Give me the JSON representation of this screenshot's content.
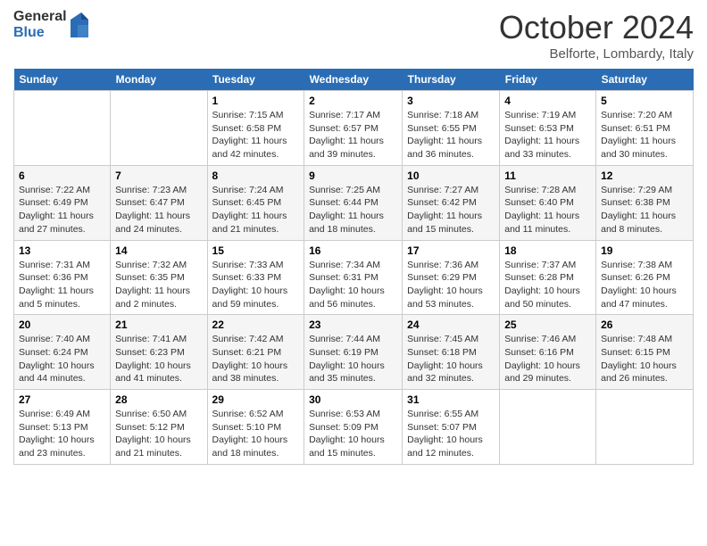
{
  "logo": {
    "general": "General",
    "blue": "Blue"
  },
  "title": "October 2024",
  "subtitle": "Belforte, Lombardy, Italy",
  "days_header": [
    "Sunday",
    "Monday",
    "Tuesday",
    "Wednesday",
    "Thursday",
    "Friday",
    "Saturday"
  ],
  "weeks": [
    [
      {
        "day": "",
        "info": ""
      },
      {
        "day": "",
        "info": ""
      },
      {
        "day": "1",
        "info": "Sunrise: 7:15 AM\nSunset: 6:58 PM\nDaylight: 11 hours and 42 minutes."
      },
      {
        "day": "2",
        "info": "Sunrise: 7:17 AM\nSunset: 6:57 PM\nDaylight: 11 hours and 39 minutes."
      },
      {
        "day": "3",
        "info": "Sunrise: 7:18 AM\nSunset: 6:55 PM\nDaylight: 11 hours and 36 minutes."
      },
      {
        "day": "4",
        "info": "Sunrise: 7:19 AM\nSunset: 6:53 PM\nDaylight: 11 hours and 33 minutes."
      },
      {
        "day": "5",
        "info": "Sunrise: 7:20 AM\nSunset: 6:51 PM\nDaylight: 11 hours and 30 minutes."
      }
    ],
    [
      {
        "day": "6",
        "info": "Sunrise: 7:22 AM\nSunset: 6:49 PM\nDaylight: 11 hours and 27 minutes."
      },
      {
        "day": "7",
        "info": "Sunrise: 7:23 AM\nSunset: 6:47 PM\nDaylight: 11 hours and 24 minutes."
      },
      {
        "day": "8",
        "info": "Sunrise: 7:24 AM\nSunset: 6:45 PM\nDaylight: 11 hours and 21 minutes."
      },
      {
        "day": "9",
        "info": "Sunrise: 7:25 AM\nSunset: 6:44 PM\nDaylight: 11 hours and 18 minutes."
      },
      {
        "day": "10",
        "info": "Sunrise: 7:27 AM\nSunset: 6:42 PM\nDaylight: 11 hours and 15 minutes."
      },
      {
        "day": "11",
        "info": "Sunrise: 7:28 AM\nSunset: 6:40 PM\nDaylight: 11 hours and 11 minutes."
      },
      {
        "day": "12",
        "info": "Sunrise: 7:29 AM\nSunset: 6:38 PM\nDaylight: 11 hours and 8 minutes."
      }
    ],
    [
      {
        "day": "13",
        "info": "Sunrise: 7:31 AM\nSunset: 6:36 PM\nDaylight: 11 hours and 5 minutes."
      },
      {
        "day": "14",
        "info": "Sunrise: 7:32 AM\nSunset: 6:35 PM\nDaylight: 11 hours and 2 minutes."
      },
      {
        "day": "15",
        "info": "Sunrise: 7:33 AM\nSunset: 6:33 PM\nDaylight: 10 hours and 59 minutes."
      },
      {
        "day": "16",
        "info": "Sunrise: 7:34 AM\nSunset: 6:31 PM\nDaylight: 10 hours and 56 minutes."
      },
      {
        "day": "17",
        "info": "Sunrise: 7:36 AM\nSunset: 6:29 PM\nDaylight: 10 hours and 53 minutes."
      },
      {
        "day": "18",
        "info": "Sunrise: 7:37 AM\nSunset: 6:28 PM\nDaylight: 10 hours and 50 minutes."
      },
      {
        "day": "19",
        "info": "Sunrise: 7:38 AM\nSunset: 6:26 PM\nDaylight: 10 hours and 47 minutes."
      }
    ],
    [
      {
        "day": "20",
        "info": "Sunrise: 7:40 AM\nSunset: 6:24 PM\nDaylight: 10 hours and 44 minutes."
      },
      {
        "day": "21",
        "info": "Sunrise: 7:41 AM\nSunset: 6:23 PM\nDaylight: 10 hours and 41 minutes."
      },
      {
        "day": "22",
        "info": "Sunrise: 7:42 AM\nSunset: 6:21 PM\nDaylight: 10 hours and 38 minutes."
      },
      {
        "day": "23",
        "info": "Sunrise: 7:44 AM\nSunset: 6:19 PM\nDaylight: 10 hours and 35 minutes."
      },
      {
        "day": "24",
        "info": "Sunrise: 7:45 AM\nSunset: 6:18 PM\nDaylight: 10 hours and 32 minutes."
      },
      {
        "day": "25",
        "info": "Sunrise: 7:46 AM\nSunset: 6:16 PM\nDaylight: 10 hours and 29 minutes."
      },
      {
        "day": "26",
        "info": "Sunrise: 7:48 AM\nSunset: 6:15 PM\nDaylight: 10 hours and 26 minutes."
      }
    ],
    [
      {
        "day": "27",
        "info": "Sunrise: 6:49 AM\nSunset: 5:13 PM\nDaylight: 10 hours and 23 minutes."
      },
      {
        "day": "28",
        "info": "Sunrise: 6:50 AM\nSunset: 5:12 PM\nDaylight: 10 hours and 21 minutes."
      },
      {
        "day": "29",
        "info": "Sunrise: 6:52 AM\nSunset: 5:10 PM\nDaylight: 10 hours and 18 minutes."
      },
      {
        "day": "30",
        "info": "Sunrise: 6:53 AM\nSunset: 5:09 PM\nDaylight: 10 hours and 15 minutes."
      },
      {
        "day": "31",
        "info": "Sunrise: 6:55 AM\nSunset: 5:07 PM\nDaylight: 10 hours and 12 minutes."
      },
      {
        "day": "",
        "info": ""
      },
      {
        "day": "",
        "info": ""
      }
    ]
  ]
}
